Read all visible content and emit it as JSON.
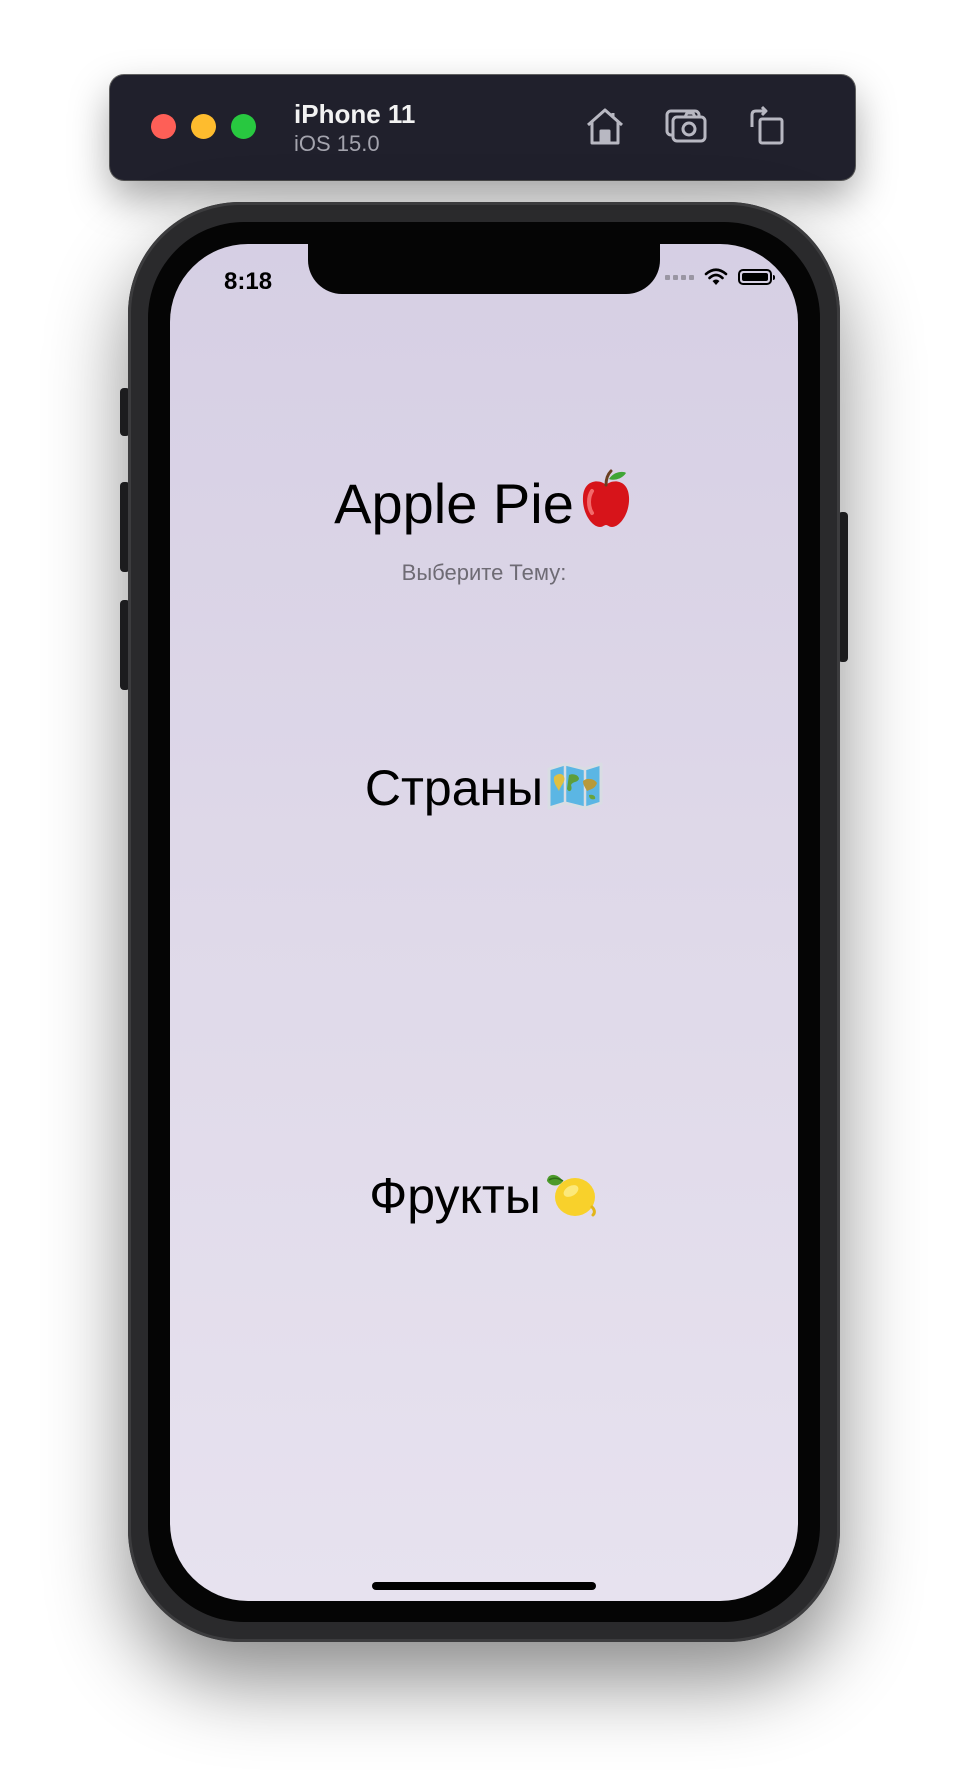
{
  "simulator": {
    "device_name": "iPhone 11",
    "os_version": "iOS 15.0",
    "toolbar_icons": [
      "home-icon",
      "screenshot-icon",
      "rotate-icon"
    ]
  },
  "status_bar": {
    "time": "8:18",
    "icons": [
      "cellular-signal-icon",
      "wifi-icon",
      "battery-icon"
    ]
  },
  "screen": {
    "title": "Apple Pie",
    "title_emoji": "red-apple-icon",
    "subtitle": "Выберите Тему:",
    "topics": [
      {
        "label": "Страны",
        "emoji": "world-map-icon"
      },
      {
        "label": "Фрукты",
        "emoji": "lemon-icon"
      }
    ]
  },
  "colors": {
    "background_top": "#d6cfe4",
    "background_bottom": "#e7e2ef",
    "simulator_bar": "#20202c"
  }
}
